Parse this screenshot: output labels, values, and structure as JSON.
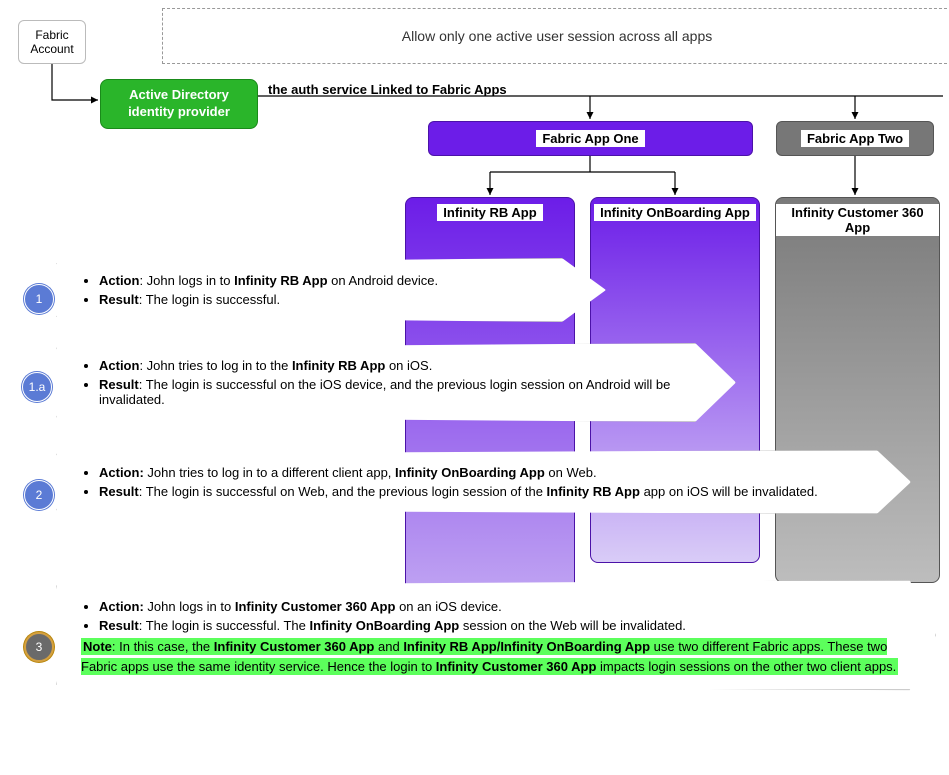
{
  "dashed_title": "Allow only one active user session across all apps",
  "fabric_account": "Fabric Account",
  "ad_provider": "Active Directory identity provider",
  "edge_label": "the auth service Linked to Fabric Apps",
  "app_one": "Fabric App One",
  "app_two": "Fabric App Two",
  "col_rb": "Infinity RB App",
  "col_ob": "Infinity OnBoarding App",
  "col_360": "Infinity Customer 360 App",
  "bubbles": {
    "b1": "1",
    "b1a": "1.a",
    "b2": "2",
    "b3": "3"
  },
  "steps": {
    "s1": {
      "action_label": "Action",
      "action_text_pre": ": John logs in to ",
      "action_app": "Infinity RB App",
      "action_text_post": " on Android device.",
      "result_label": "Result",
      "result_text": ": The login is successful."
    },
    "s1a": {
      "action_label": "Action",
      "action_text_pre": ": John tries to log in to the ",
      "action_app": "Infinity RB App",
      "action_text_post": " on iOS.",
      "result_label": "Result",
      "result_text": ": The login is successful on the iOS device, and the previous login session on Android will be invalidated."
    },
    "s2": {
      "action_label": "Action:",
      "action_text_pre": " John tries to log in to a different client app, ",
      "action_app": "Infinity OnBoarding App",
      "action_text_post": " on Web.",
      "result_label": "Result",
      "result_text_pre": ": The login is successful on Web, and the previous login session of the ",
      "result_app": "Infinity RB App",
      "result_text_post": " app on iOS will be invalidated."
    },
    "s3": {
      "action_label": "Action:",
      "action_text_pre": " John logs in to ",
      "action_app": "Infinity Customer 360 App",
      "action_text_post": " on an iOS device.",
      "result_label": "Result",
      "result_text_pre": ": The login is successful. The ",
      "result_app": "Infinity OnBoarding App",
      "result_text_post": " session on the Web will be invalidated.",
      "note_label": "Note",
      "note_pre": ": In this case, the ",
      "note_b1": "Infinity Customer 360 App",
      "note_mid1": " and ",
      "note_b2": "Infinity RB App/Infinity OnBoarding App",
      "note_mid2": " use two different Fabric apps. These two Fabric apps use the same identity service. Hence the login to ",
      "note_b3": "Infinity Customer 360 App",
      "note_post": " impacts login sessions on the other two client apps."
    }
  }
}
